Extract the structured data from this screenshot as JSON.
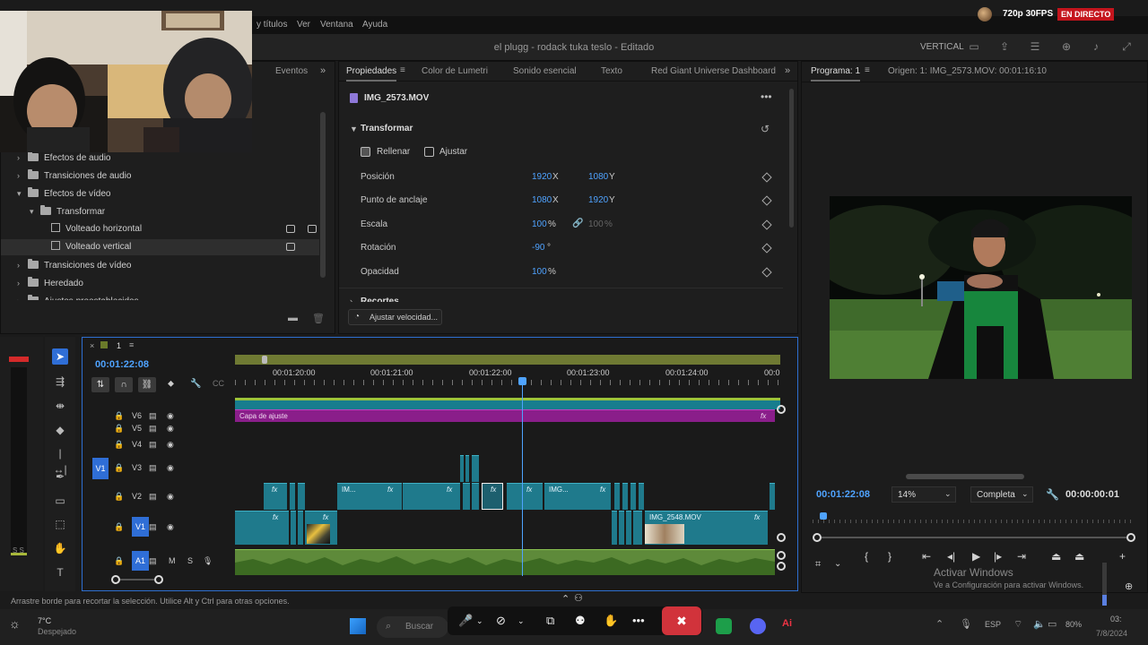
{
  "menu": {
    "items": [
      "y títulos",
      "Ver",
      "Ventana",
      "Ayuda"
    ]
  },
  "stream": {
    "quality": "720p 30FPS",
    "live": "EN DIRECTO"
  },
  "title": {
    "document": "el plugg - rodack tuka teslo - Editado",
    "workspace": "VERTICAL"
  },
  "effects_panel": {
    "tab": "Eventos",
    "items": [
      {
        "label": "Efectos de audio",
        "depth": 0,
        "expanded": false,
        "type": "folder"
      },
      {
        "label": "Transiciones de audio",
        "depth": 0,
        "expanded": false,
        "type": "folder"
      },
      {
        "label": "Efectos de vídeo",
        "depth": 0,
        "expanded": true,
        "type": "folder"
      },
      {
        "label": "Transformar",
        "depth": 1,
        "expanded": true,
        "type": "folder"
      },
      {
        "label": "Volteado horizontal",
        "depth": 2,
        "type": "effect"
      },
      {
        "label": "Volteado vertical",
        "depth": 2,
        "type": "effect",
        "selected": true
      },
      {
        "label": "Transiciones de vídeo",
        "depth": 0,
        "expanded": false,
        "type": "folder"
      },
      {
        "label": "Heredado",
        "depth": 0,
        "expanded": false,
        "type": "folder"
      },
      {
        "label": "Ajustes preestablecidos",
        "depth": 0,
        "expanded": false,
        "type": "folder"
      }
    ]
  },
  "properties": {
    "tabs": [
      "Propiedades",
      "Color de Lumetri",
      "Sonido esencial",
      "Texto",
      "Red Giant Universe Dashboard"
    ],
    "clip_name": "IMG_2573.MOV",
    "section": "Transformar",
    "fill_label": "Rellenar",
    "fit_label": "Ajustar",
    "rows": [
      {
        "label": "Posición",
        "v1": "1920",
        "u1": "X",
        "v2": "1080",
        "u2": "Y"
      },
      {
        "label": "Punto de anclaje",
        "v1": "1080",
        "u1": "X",
        "v2": "1920",
        "u2": "Y"
      },
      {
        "label": "Escala",
        "v1": "100",
        "u1": "%",
        "v2": "100",
        "u2": "%"
      },
      {
        "label": "Rotación",
        "v1": "-90",
        "u1": "°",
        "v2": "",
        "u2": ""
      },
      {
        "label": "Opacidad",
        "v1": "100",
        "u1": "%",
        "v2": "",
        "u2": ""
      }
    ],
    "next_section": "Recortes",
    "speed_button": "Ajustar velocidad..."
  },
  "program": {
    "tab": "Programa: 1",
    "source": "Origen: 1: IMG_2573.MOV: 00:01:16:10",
    "timecode": "00:01:22:08",
    "zoom": "14%",
    "quality": "Completa",
    "duration": "00:00:00:01"
  },
  "timeline": {
    "sequence": "1",
    "timecode": "00:01:22:08",
    "ruler": [
      "00:01:20:00",
      "00:01:21:00",
      "00:01:22:00",
      "00:01:23:00",
      "00:01:24:00",
      "00:0"
    ],
    "tracks": [
      "V6",
      "V5",
      "V4",
      "V3",
      "V2",
      "V1",
      "A1"
    ],
    "source_v": "V1",
    "source_a": "A1",
    "audio_m": "M",
    "audio_s": "S",
    "adjust_layer": "Capa de ajuste",
    "clips": [
      "IM...",
      "IMG...",
      "IMG_2548.MOV"
    ],
    "fx": "fx"
  },
  "status": {
    "hint": "Arrastre borde para recortar la selección. Utilice Alt y Ctrl para otras opciones."
  },
  "watermark": {
    "title": "Activar Windows",
    "subtitle": "Ve a Configuración para activar Windows."
  },
  "taskbar": {
    "search": "Buscar",
    "weather_temp": "7°C",
    "weather_desc": "Despejado",
    "lang": "ESP",
    "battery": "80%",
    "time": "03:",
    "date": "7/8/2024"
  }
}
